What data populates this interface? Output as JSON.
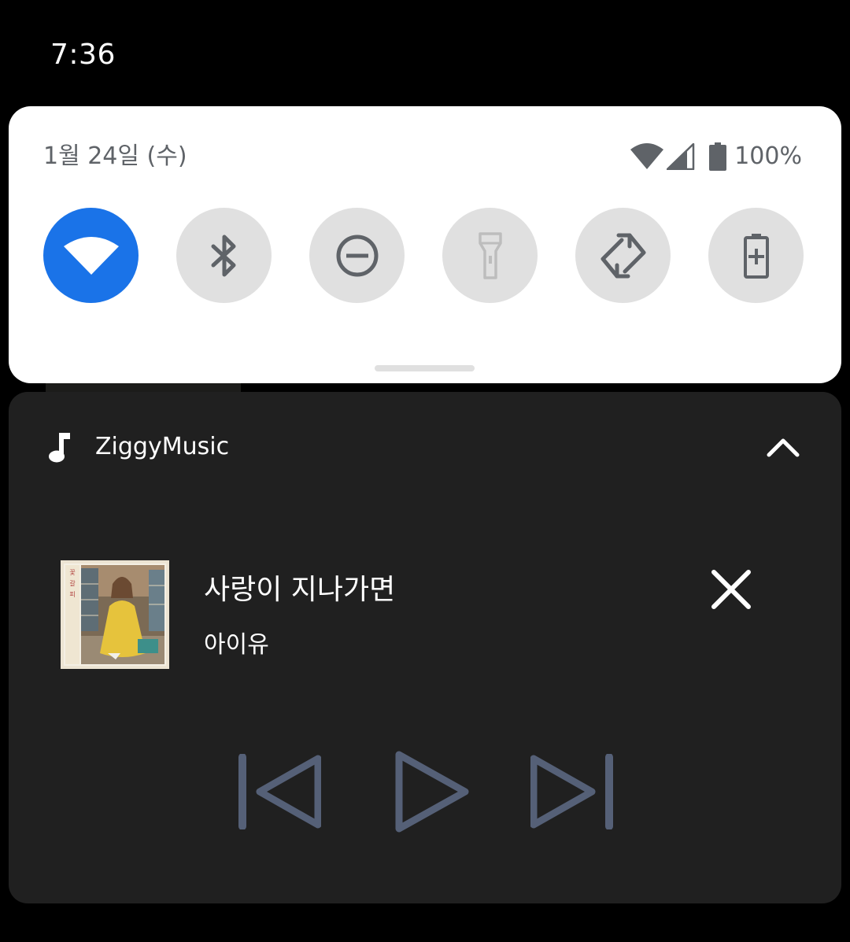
{
  "status_bar": {
    "time": "7:36"
  },
  "quick_settings": {
    "date": "1월 24일 (수)",
    "battery_percent": "100%",
    "tiles": [
      {
        "name": "wifi",
        "icon": "wifi-icon",
        "active": true
      },
      {
        "name": "bluetooth",
        "icon": "bluetooth-icon",
        "active": false
      },
      {
        "name": "do-not-disturb",
        "icon": "do-not-disturb-icon",
        "active": false
      },
      {
        "name": "flashlight",
        "icon": "flashlight-icon",
        "active": false
      },
      {
        "name": "auto-rotate",
        "icon": "auto-rotate-icon",
        "active": false
      },
      {
        "name": "battery-saver",
        "icon": "battery-saver-icon",
        "active": false
      }
    ],
    "colors": {
      "active_tile": "#1a73e8",
      "inactive_tile": "#e0e0e0",
      "icon_gray": "#5f6368"
    }
  },
  "media_notification": {
    "app_name": "ZiggyMusic",
    "app_icon": "music-note-icon",
    "song_title": "사랑이 지나가면",
    "artist": "아이유",
    "controls": [
      "previous-icon",
      "play-icon",
      "next-icon"
    ],
    "colors": {
      "background": "#202020",
      "controls": "#556077"
    }
  }
}
